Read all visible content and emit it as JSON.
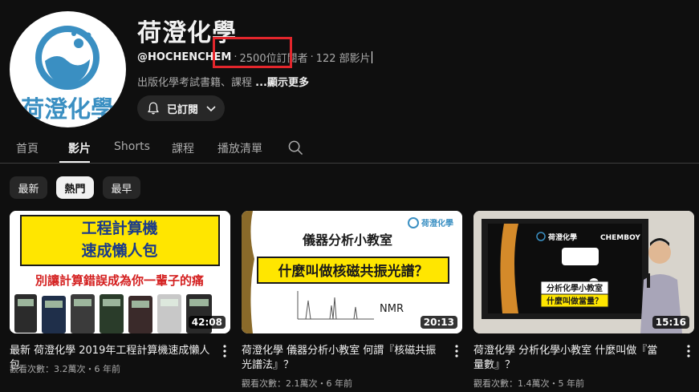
{
  "channel": {
    "title": "荷澄化學",
    "handle": "@HOCHENCHEM",
    "subscribers": "2500位訂閱者",
    "video_count": "122 部影片",
    "description": "出版化學考試書籍、課程 ",
    "more_label": "...顯示更多",
    "avatar_text": "荷澄化學",
    "subscribe_label": "已訂閱",
    "dot_separator": "·"
  },
  "tabs": [
    {
      "label": "首頁"
    },
    {
      "label": "影片"
    },
    {
      "label": "Shorts"
    },
    {
      "label": "課程"
    },
    {
      "label": "播放清單"
    }
  ],
  "chips": [
    {
      "label": "最新"
    },
    {
      "label": "熱門"
    },
    {
      "label": "最早"
    }
  ],
  "videos": [
    {
      "title": "最新 荷澄化學 2019年工程計算機速成懶人包",
      "stats": "觀看次數：3.2萬次・6 年前",
      "duration": "42:08",
      "thumb_text": [
        "工程計算機",
        "速成懶人包",
        "別讓計算錯誤成為你一輩子的痛"
      ]
    },
    {
      "title": "荷澄化學 儀器分析小教室 何謂『核磁共振光譜法』？",
      "stats": "觀看次數：2.1萬次・6 年前",
      "duration": "20:13",
      "thumb_text": [
        "荷澄化學",
        "儀器分析小教室",
        "什麼叫做核磁共振光譜？",
        "NMR"
      ]
    },
    {
      "title": "荷澄化學 分析化學小教室 什麼叫做『當量數』？",
      "stats": "觀看次數：1.4萬次・5 年前",
      "duration": "15:16",
      "thumb_text": [
        "荷澄化學",
        "CHEMBOY",
        "分析化學小教室",
        "什麼叫做當量？"
      ]
    }
  ],
  "colors": {
    "background": "#0f0f0f",
    "brand_blue": "#3a8fc2",
    "highlight_red": "#e3262c",
    "banner_yellow": "#ffe600"
  }
}
